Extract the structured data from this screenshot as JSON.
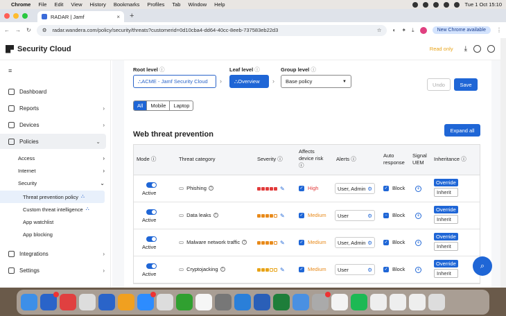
{
  "menubar": {
    "app": "Chrome",
    "items": [
      "File",
      "Edit",
      "View",
      "History",
      "Bookmarks",
      "Profiles",
      "Tab",
      "Window",
      "Help"
    ],
    "clock": "Tue 1 Oct  15:10"
  },
  "browser": {
    "tab_title": "RADAR | Jamf",
    "url": "radar.wandera.com/policy/security/threats?customerid=0d10cba4-dd64-40cc-8eeb-737583eb22d3",
    "new_chrome": "New Chrome available"
  },
  "app": {
    "logo": "Security Cloud",
    "readonly": "Read only",
    "sidebar": {
      "dashboard": "Dashboard",
      "reports": "Reports",
      "devices": "Devices",
      "policies": "Policies",
      "access": "Access",
      "internet": "Internet",
      "security": "Security",
      "leaf_items": [
        "Threat prevention policy",
        "Custom threat intelligence",
        "App watchlist",
        "App blocking"
      ],
      "integrations": "Integrations",
      "settings": "Settings"
    },
    "levels": {
      "root_label": "Root level",
      "root_value": "ACME - Jamf Security Cloud",
      "leaf_label": "Leaf level",
      "leaf_value": "Overview",
      "group_label": "Group level",
      "group_value": "Base policy"
    },
    "undo": "Undo",
    "save": "Save",
    "filters": [
      "All",
      "Mobile",
      "Laptop"
    ],
    "section_title": "Web threat prevention",
    "expand_all": "Expand all",
    "table": {
      "headers": {
        "mode": "Mode",
        "category": "Threat category",
        "severity": "Severity",
        "affects1": "Affects",
        "affects2": "device risk",
        "alerts": "Alerts",
        "auto1": "Auto",
        "auto2": "response",
        "signal1": "Signal",
        "signal2": "UEM",
        "inheritance": "Inheritance"
      },
      "rows": [
        {
          "mode": "Active",
          "category": "Phishing",
          "severity_level": 5,
          "severity_color": "#e23b3b",
          "risk": "High",
          "risk_color": "#e23b3b",
          "alerts": "User, Admin",
          "response": "Block",
          "override": "Override",
          "inherit": "Inherit"
        },
        {
          "mode": "Active",
          "category": "Data leaks",
          "severity_level": 4,
          "severity_color": "#e88a1a",
          "risk": "Medium",
          "risk_color": "#e88a1a",
          "alerts": "User",
          "response": "Block",
          "override": "Override",
          "inherit": "Inherit"
        },
        {
          "mode": "Active",
          "category": "Malware network traffic",
          "severity_level": 4,
          "severity_color": "#e88a1a",
          "risk": "Medium",
          "risk_color": "#e88a1a",
          "alerts": "User, Admin",
          "response": "Block",
          "override": "Override",
          "inherit": "Inherit"
        },
        {
          "mode": "Active",
          "category": "Cryptojacking",
          "severity_level": 3,
          "severity_color": "#e8a317",
          "risk": "Medium",
          "risk_color": "#e88a1a",
          "alerts": "User",
          "response": "Block",
          "override": "Override",
          "inherit": "Inherit"
        }
      ]
    }
  },
  "dock": {
    "colors": [
      "#3d8fe8",
      "#2a64c9",
      "#e04040",
      "#ddd",
      "#2a64c9",
      "#f0a020",
      "#2d8cff",
      "#ddd",
      "#30a030",
      "#f6f6f6",
      "#777",
      "#2a7fd9",
      "#2a5fb8",
      "#1e7e3a",
      "#4a90e2",
      "#aaa",
      "#f3f3f3",
      "#1db954",
      "#eee",
      "#eee",
      "#eee",
      "#ddd"
    ]
  }
}
